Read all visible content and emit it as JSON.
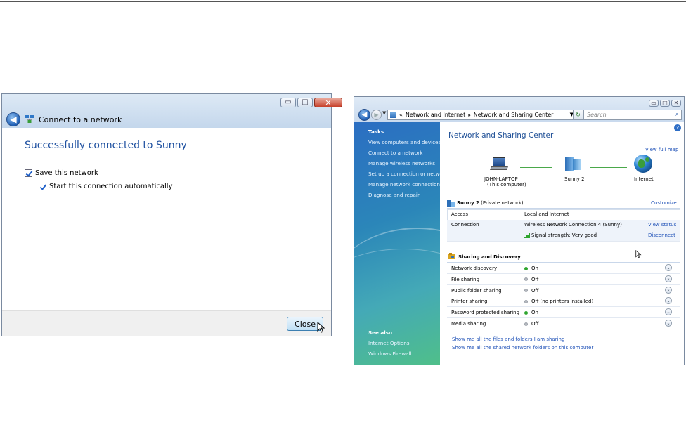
{
  "dialog": {
    "title": "Connect to a network",
    "headline": "Successfully connected to Sunny",
    "save_network": {
      "label": "Save this network",
      "checked": true
    },
    "auto_start": {
      "label": "Start this connection automatically",
      "checked": true
    },
    "close_label": "Close",
    "window_buttons": {
      "minimize": "▭",
      "maximize": "□",
      "close": "✕"
    }
  },
  "nsc": {
    "address": {
      "prefix": "«",
      "crumb1": "Network and Internet",
      "crumb2": "Network and Sharing Center",
      "sep": "▸"
    },
    "search_placeholder": "Search",
    "window_buttons": {
      "minimize": "▭",
      "maximize": "□",
      "close": "✕"
    },
    "sidebar": {
      "tasks_heading": "Tasks",
      "tasks": [
        "View computers and devices",
        "Connect to a network",
        "Manage wireless networks",
        "Set up a connection or network",
        "Manage network connections",
        "Diagnose and repair"
      ],
      "see_also_heading": "See also",
      "see_also": [
        "Internet Options",
        "Windows Firewall"
      ]
    },
    "title": "Network and Sharing Center",
    "view_full_map": "View full map",
    "map": {
      "computer_line1": "JOHN-LAPTOP",
      "computer_line2": "(This computer)",
      "network": "Sunny  2",
      "internet": "Internet"
    },
    "network_section": {
      "name": "Sunny  2",
      "type": "(Private network)",
      "customize": "Customize",
      "rows": [
        {
          "label": "Access",
          "value": "Local and Internet",
          "link": ""
        },
        {
          "label": "Connection",
          "value": "Wireless Network Connection 4 (Sunny)",
          "link": "View status"
        },
        {
          "label": "",
          "value": "Signal strength:  Very good",
          "link": "Disconnect"
        }
      ]
    },
    "sharing_section": {
      "title": "Sharing and Discovery",
      "rows": [
        {
          "label": "Network discovery",
          "status": "On",
          "on": true
        },
        {
          "label": "File sharing",
          "status": "Off",
          "on": false
        },
        {
          "label": "Public folder sharing",
          "status": "Off",
          "on": false
        },
        {
          "label": "Printer sharing",
          "status": "Off (no printers installed)",
          "on": false
        },
        {
          "label": "Password protected sharing",
          "status": "On",
          "on": true
        },
        {
          "label": "Media sharing",
          "status": "Off",
          "on": false
        }
      ]
    },
    "footer_links": [
      "Show me all the files and folders I am sharing",
      "Show me all the shared network folders on this computer"
    ],
    "help_glyph": "?",
    "expander_glyph": "⌄"
  },
  "colors": {
    "link": "#2153b8",
    "heading_blue": "#1e4f96",
    "status_on": "#2fa52f"
  }
}
